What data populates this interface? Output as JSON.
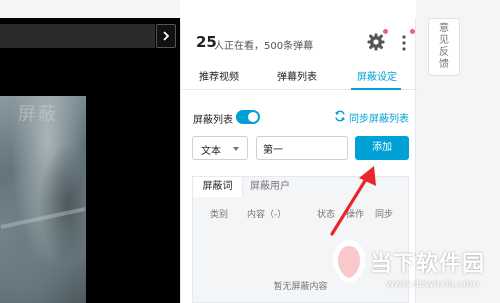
{
  "player": {
    "collapse_icon": "chevron-right-icon",
    "frame_watermark": "屏蔽"
  },
  "header": {
    "viewer_count": "25",
    "viewer_text": "人正在看，500条弹幕",
    "settings_icon": "gear-icon",
    "more_icon": "more-vertical-icon"
  },
  "tabs": [
    {
      "label": "推荐视频"
    },
    {
      "label": "弹幕列表"
    },
    {
      "label": "屏蔽设定"
    }
  ],
  "active_tab_index": 2,
  "shield": {
    "label": "屏蔽列表",
    "toggle_on": true,
    "sync_label": "同步屏蔽列表",
    "sync_icon": "sync-icon"
  },
  "filter": {
    "type_selected": "文本",
    "input_value": "第一",
    "add_label": "添加"
  },
  "list": {
    "subtabs": [
      {
        "label": "屏蔽词"
      },
      {
        "label": "屏蔽用户"
      }
    ],
    "columns": [
      "类别",
      "内容（-）",
      "状态",
      "操作",
      "同步"
    ],
    "empty_text": "暂无屏蔽内容"
  },
  "feedback": {
    "label": "意见反馈"
  },
  "watermark": {
    "brand": "当下软件园",
    "url": "www.downxia.com"
  },
  "colors": {
    "accent": "#00a1d6",
    "notice_dot": "#f25d8e",
    "arrow": "#e8262b"
  }
}
